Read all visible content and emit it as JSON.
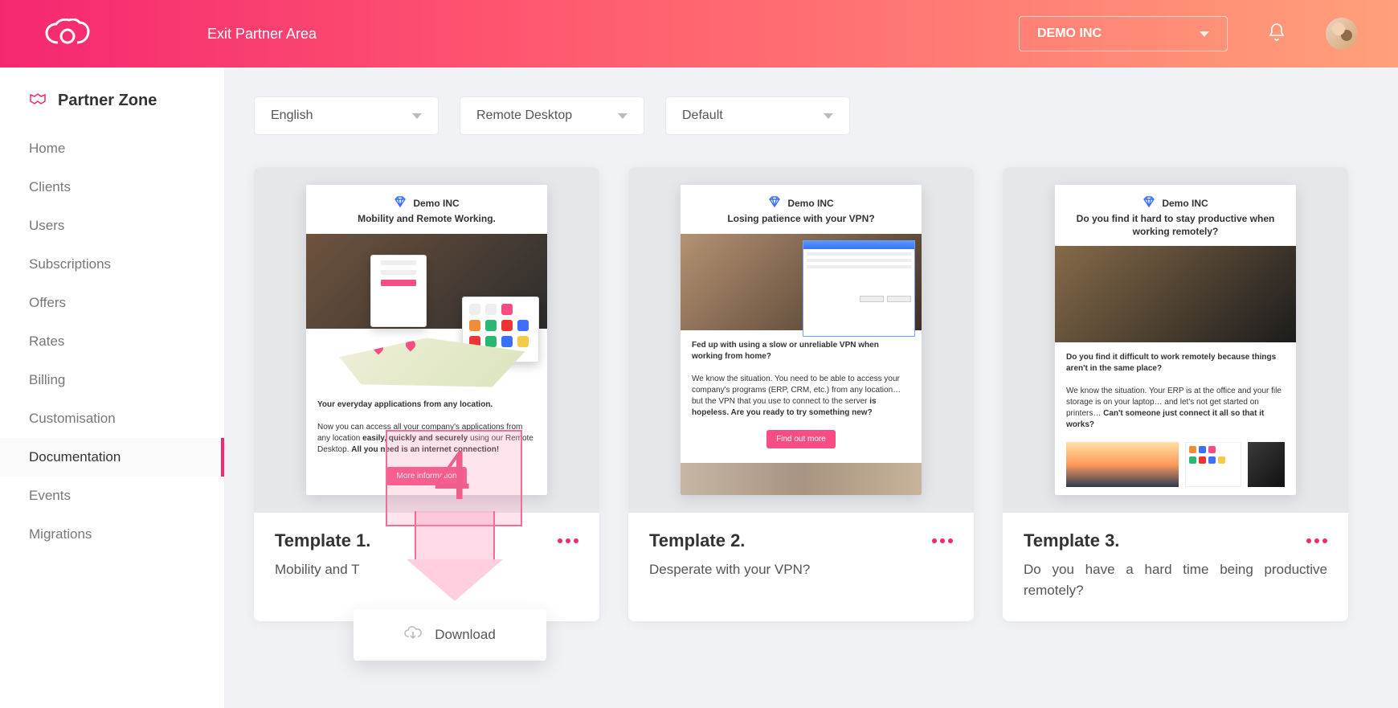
{
  "header": {
    "exit_label": "Exit Partner Area",
    "account_label": "DEMO INC"
  },
  "sidebar": {
    "title": "Partner Zone",
    "items": [
      {
        "label": "Home"
      },
      {
        "label": "Clients"
      },
      {
        "label": "Users"
      },
      {
        "label": "Subscriptions"
      },
      {
        "label": "Offers"
      },
      {
        "label": "Rates"
      },
      {
        "label": "Billing"
      },
      {
        "label": "Customisation"
      },
      {
        "label": "Documentation"
      },
      {
        "label": "Events"
      },
      {
        "label": "Migrations"
      }
    ],
    "active_index": 8
  },
  "filters": {
    "language": "English",
    "product": "Remote Desktop",
    "variant": "Default"
  },
  "annotation": {
    "step_number": "4",
    "action": "Download"
  },
  "cards": [
    {
      "title": "Template 1.",
      "subtitle": "Mobility and T",
      "preview": {
        "brand": "Demo INC",
        "headline": "Mobility and Remote Working.",
        "body_title": "Your everyday applications from any location.",
        "body_text_1": "Now you can access all your company's applications from any location",
        "body_text_2a": "easily, quickly and securely",
        "body_text_2b": " using our Remote Desktop. ",
        "body_text_3": "All you need is an internet connection!",
        "cta": "More information"
      }
    },
    {
      "title": "Template 2.",
      "subtitle": "Desperate with your VPN?",
      "preview": {
        "brand": "Demo INC",
        "headline": "Losing patience with your VPN?",
        "sub_headline": "Fed up with using a slow or unreliable VPN when working from home?",
        "body_text_1": "We know the situation. You need to be able to access your company's programs (ERP, CRM, etc.) from any location… but the VPN that you use to connect to the server ",
        "body_text_2": "is hopeless. Are you ready to try something new?",
        "cta": "Find out more"
      }
    },
    {
      "title": "Template 3.",
      "subtitle": "Do you have a hard time being productive remotely?",
      "preview": {
        "brand": "Demo INC",
        "headline": "Do you find it hard to stay productive when working remotely?",
        "sub_headline": "Do you find it difficult to work remotely because things aren't in the same place?",
        "body_text_1": "We know the situation. Your ERP is at the office and your file storage is on your laptop… and let's not get started on printers… ",
        "body_text_2": "Can't someone just connect it all so that it works?"
      }
    }
  ]
}
